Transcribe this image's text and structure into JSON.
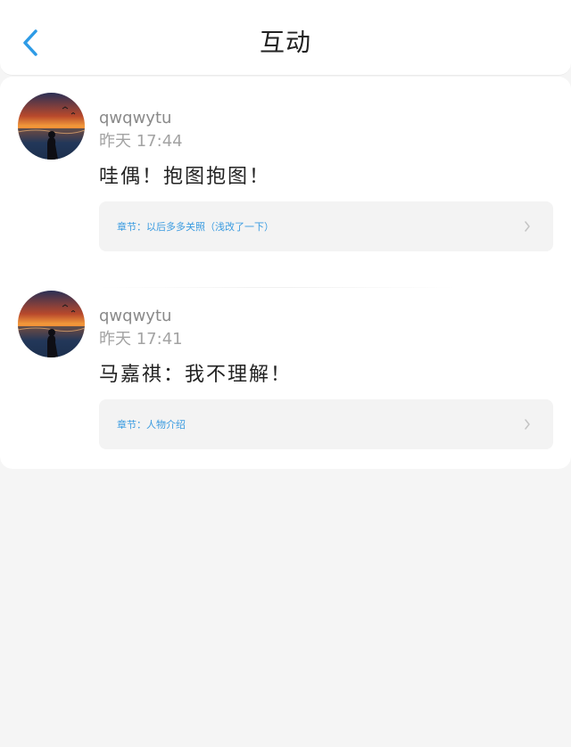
{
  "header": {
    "title": "互动",
    "back_icon": "chevron-left-icon",
    "accent_color": "#2e9be6"
  },
  "comments": [
    {
      "username": "qwqwytu",
      "time": "昨天 17:44",
      "text": "哇偶！抱图抱图！",
      "chapter": "章节：以后多多关照（浅改了一下）"
    },
    {
      "username": "qwqwytu",
      "time": "昨天 17:41",
      "text": "马嘉祺：我不理解！",
      "chapter": "章节：人物介绍"
    }
  ]
}
